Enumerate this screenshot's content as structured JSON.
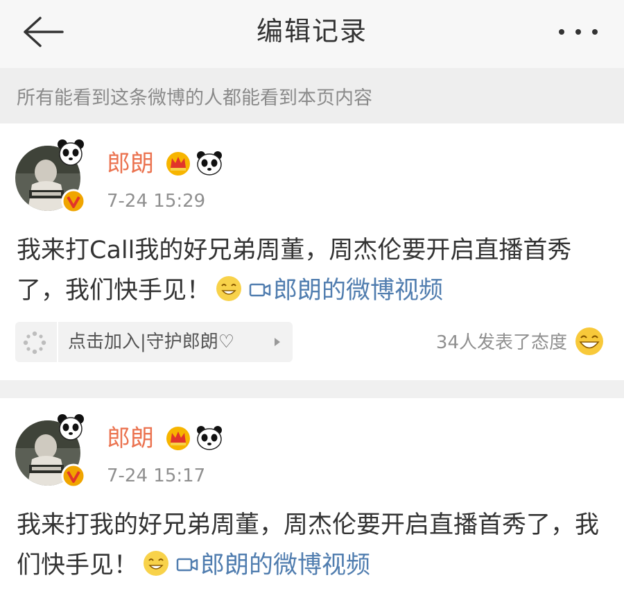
{
  "header": {
    "title": "编辑记录",
    "back_icon": "arrow-left-icon",
    "more_icon": "more-dots-icon"
  },
  "notice": {
    "text": "所有能看到这条微博的人都能看到本页内容"
  },
  "colors": {
    "username": "#eb7350",
    "link": "#507daf",
    "muted": "#8f8f8f",
    "verified_badge": "#f0a500"
  },
  "posts": [
    {
      "user_name": "郎朗",
      "time": "7-24 15:29",
      "text": "我来打Call我的好兄弟周董，周杰伦要开启直播首秀了，我们快手见！",
      "link_text": "郎朗的微博视频",
      "guard_chip_label": "点击加入|守护郎朗♡",
      "reaction_text": "34人发表了态度"
    },
    {
      "user_name": "郎朗",
      "time": "7-24 15:17",
      "text": "我来打我的好兄弟周董，周杰伦要开启直播首秀了，我们快手见！",
      "link_text": "郎朗的微博视频"
    }
  ]
}
